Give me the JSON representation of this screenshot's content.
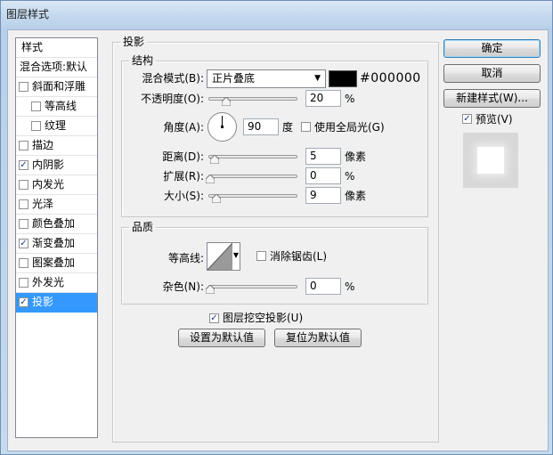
{
  "window": {
    "title": "图层样式"
  },
  "style_list": {
    "items": [
      {
        "label": "样式",
        "checkbox": null,
        "checked": false,
        "selected": false,
        "indent": false
      },
      {
        "label": "混合选项:默认",
        "checkbox": null,
        "checked": false,
        "selected": false,
        "indent": false
      },
      {
        "label": "斜面和浮雕",
        "checkbox": true,
        "checked": false,
        "selected": false,
        "indent": false
      },
      {
        "label": "等高线",
        "checkbox": true,
        "checked": false,
        "selected": false,
        "indent": true
      },
      {
        "label": "纹理",
        "checkbox": true,
        "checked": false,
        "selected": false,
        "indent": true
      },
      {
        "label": "描边",
        "checkbox": true,
        "checked": false,
        "selected": false,
        "indent": false
      },
      {
        "label": "内阴影",
        "checkbox": true,
        "checked": true,
        "selected": false,
        "indent": false
      },
      {
        "label": "内发光",
        "checkbox": true,
        "checked": false,
        "selected": false,
        "indent": false
      },
      {
        "label": "光泽",
        "checkbox": true,
        "checked": false,
        "selected": false,
        "indent": false
      },
      {
        "label": "颜色叠加",
        "checkbox": true,
        "checked": false,
        "selected": false,
        "indent": false
      },
      {
        "label": "渐变叠加",
        "checkbox": true,
        "checked": true,
        "selected": false,
        "indent": false
      },
      {
        "label": "图案叠加",
        "checkbox": true,
        "checked": false,
        "selected": false,
        "indent": false
      },
      {
        "label": "外发光",
        "checkbox": true,
        "checked": false,
        "selected": false,
        "indent": false
      },
      {
        "label": "投影",
        "checkbox": true,
        "checked": true,
        "selected": true,
        "indent": false
      }
    ]
  },
  "drop_shadow": {
    "title": "投影",
    "structure": {
      "title": "结构",
      "blend_mode_label": "混合模式(B):",
      "blend_mode_value": "正片叠底",
      "color_hex": "#000000",
      "opacity_label": "不透明度(O):",
      "opacity_value": "20",
      "opacity_unit": "%",
      "opacity_level": 0.2,
      "angle_label": "角度(A):",
      "angle_value": "90",
      "angle_unit": "度",
      "global_light_label": "使用全局光(G)",
      "global_light_checked": false,
      "distance_label": "距离(D):",
      "distance_value": "5",
      "distance_unit": "像素",
      "spread_label": "扩展(R):",
      "spread_value": "0",
      "spread_unit": "%",
      "size_label": "大小(S):",
      "size_value": "9",
      "size_unit": "像素"
    },
    "quality": {
      "title": "品质",
      "contour_label": "等高线:",
      "antialias_label": "消除锯齿(L)",
      "antialias_checked": false,
      "noise_label": "杂色(N):",
      "noise_value": "0",
      "noise_unit": "%"
    },
    "knockout_label": "图层挖空投影(U)",
    "knockout_checked": true,
    "make_default_label": "设置为默认值",
    "reset_default_label": "复位为默认值"
  },
  "buttons": {
    "ok": "确定",
    "cancel": "取消",
    "new_style": "新建样式(W)...",
    "preview_label": "预览(V)",
    "preview_checked": true
  },
  "colors": {
    "selection": "#3399ff",
    "checkmark": "#1e3a8a"
  }
}
